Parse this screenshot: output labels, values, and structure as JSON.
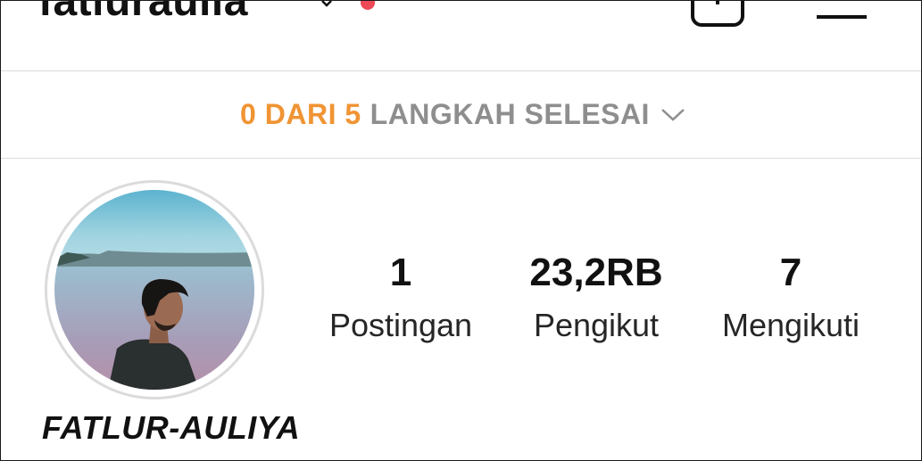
{
  "header": {
    "username": "fatluraulia",
    "icons": [
      "chevron-down-icon",
      "notification-dot-icon",
      "new-post-icon",
      "menu-icon"
    ],
    "notification_color": "#ed4956"
  },
  "steps": {
    "progress": "0 DARI 5",
    "rest": "LANGKAH SELESAI",
    "progress_color": "#f09433",
    "rest_color": "#8e8e8e"
  },
  "profile": {
    "display_name": "FATLUR-AULIYA",
    "stats": [
      {
        "value": "1",
        "label": "Postingan"
      },
      {
        "value": "23,2RB",
        "label": "Pengikut"
      },
      {
        "value": "7",
        "label": "Mengikuti"
      }
    ]
  }
}
